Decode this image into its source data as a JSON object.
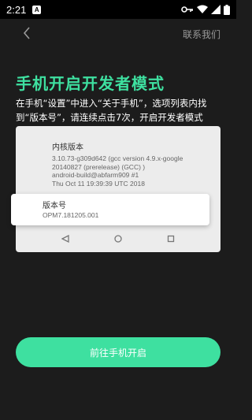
{
  "status_bar": {
    "time": "2:21",
    "notification_glyph": "A",
    "icons": [
      "key-icon",
      "wifi-icon",
      "signal-icon",
      "battery-icon"
    ]
  },
  "header": {
    "back_icon": "chevron-left-icon",
    "contact_label": "联系我们"
  },
  "title": "手机开启开发者模式",
  "description": "在手机“设置”中进入“关于手机”，选项列表内找到“版本号”，请连续点击7次，开启开发者模式",
  "example_screen": {
    "kernel_title": "内核版本",
    "kernel_lines": [
      "3.10.73-g309d642 (gcc version 4.9.x-google",
      "20140827 (prerelease) (GCC) )",
      "android-build@abfarm909 #1",
      "Thu Oct 11 19:39:39 UTC 2018"
    ],
    "build_label": "版本号",
    "build_value": "OPM7.181205.001",
    "nav_icons": [
      "back-triangle-icon",
      "home-circle-icon",
      "recents-square-icon"
    ]
  },
  "primary_button_label": "前往手机开启",
  "colors": {
    "accent": "#3ee0a0",
    "background": "#1c1c1c",
    "status_bar": "#000000"
  }
}
